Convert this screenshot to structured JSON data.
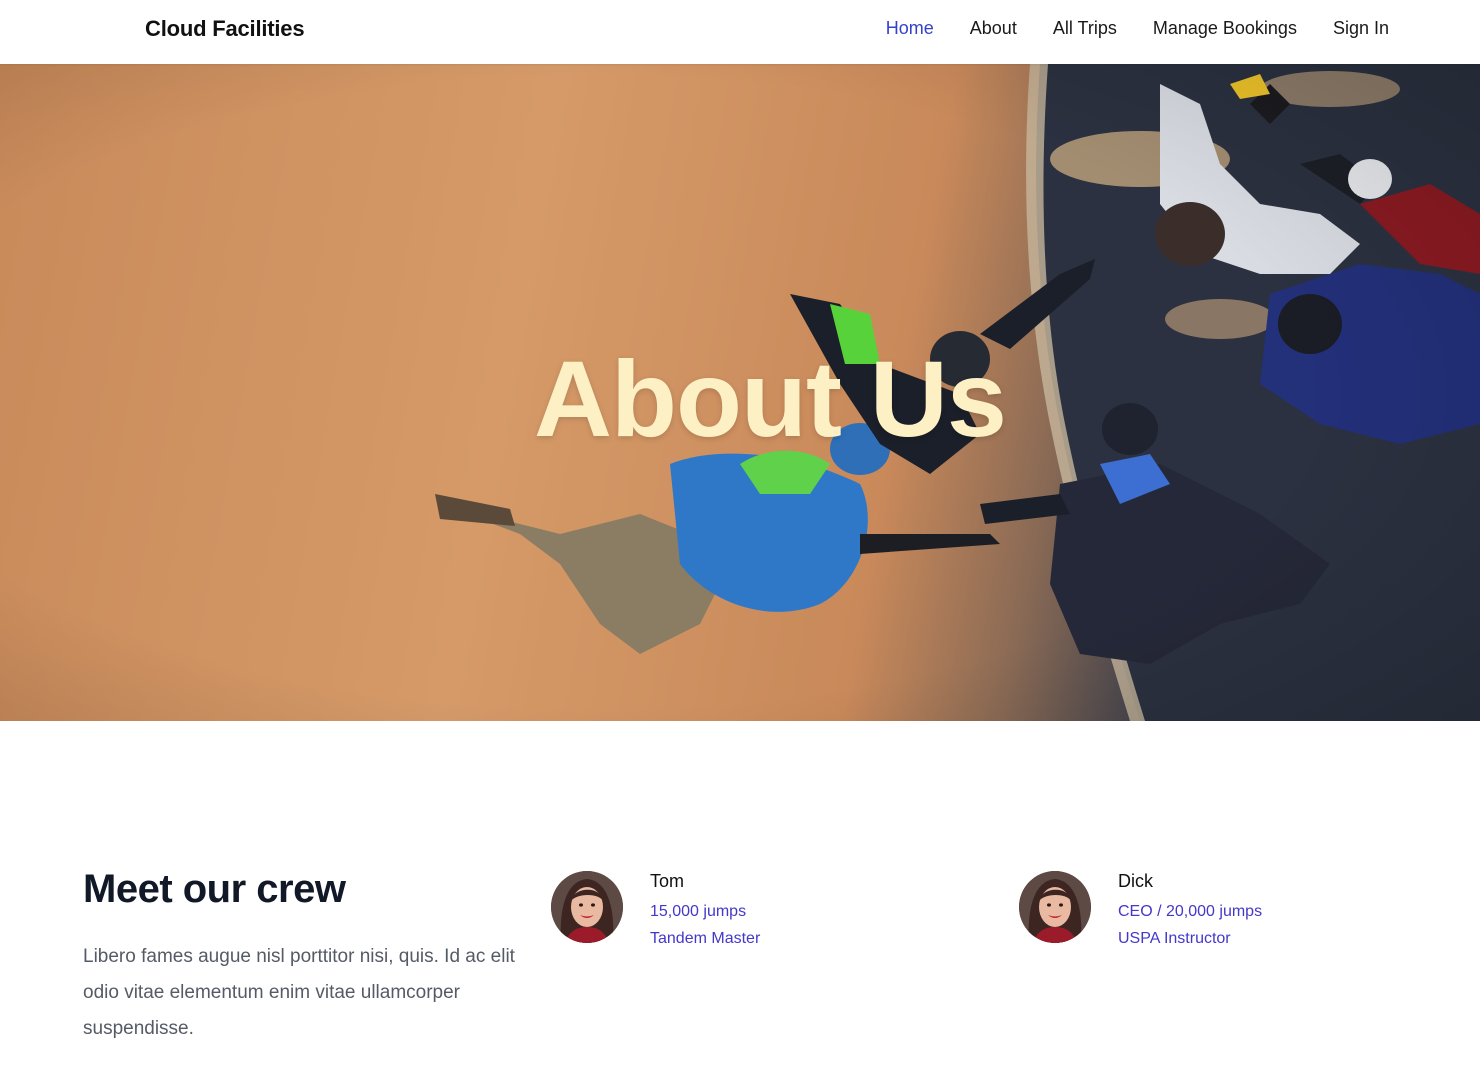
{
  "navbar": {
    "brand": "Cloud Facilities",
    "links": [
      {
        "label": "Home",
        "active": true
      },
      {
        "label": "About",
        "active": false
      },
      {
        "label": "All Trips",
        "active": false
      },
      {
        "label": "Manage Bookings",
        "active": false
      },
      {
        "label": "Sign In",
        "active": false
      }
    ]
  },
  "hero": {
    "title": "About Us",
    "image": "skydivers-formation-photo"
  },
  "crew": {
    "heading": "Meet our crew",
    "description": "Libero fames augue nisl porttitor nisi, quis. Id ac elit odio vitae elementum enim vitae ullamcorper suspendisse.",
    "members": [
      {
        "name": "Tom",
        "line1": "15,000 jumps",
        "line2": "Tandem Master"
      },
      {
        "name": "Dick",
        "line1": "CEO / 20,000 jumps",
        "line2": "USPA Instructor"
      }
    ]
  },
  "colors": {
    "accent": "#3442c9",
    "hero_title": "#fdf0c4",
    "member_detail": "#4338ca",
    "heading": "#111827",
    "body_text": "#555b66"
  }
}
